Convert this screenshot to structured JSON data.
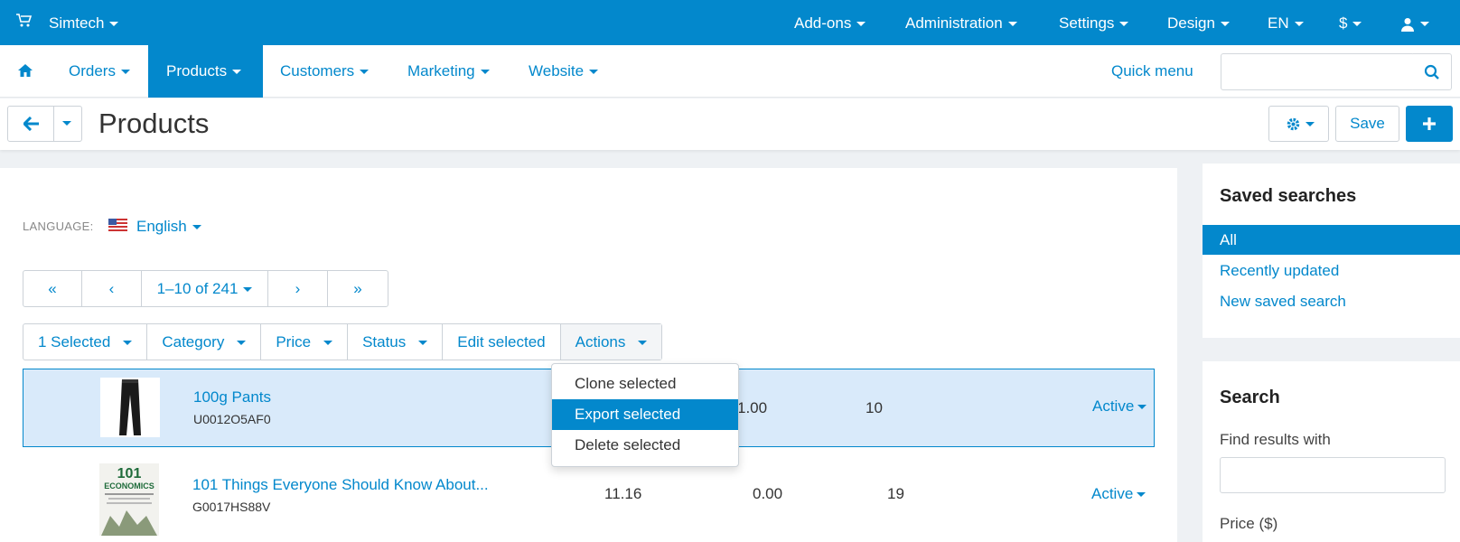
{
  "topbar": {
    "store": "Simtech",
    "menu": [
      "Add-ons",
      "Administration",
      "Settings",
      "Design",
      "EN",
      "$"
    ]
  },
  "nav": {
    "items": [
      "Orders",
      "Products",
      "Customers",
      "Marketing",
      "Website"
    ],
    "active": "Products",
    "quick_menu": "Quick menu",
    "search_placeholder": ""
  },
  "titlebar": {
    "title": "Products",
    "save": "Save"
  },
  "language": {
    "label": "LANGUAGE:",
    "value": "English"
  },
  "pager": {
    "first": "«",
    "prev": "‹",
    "range": "1–10 of 241",
    "next": "›",
    "last": "»"
  },
  "toolbar": {
    "selected": "1 Selected",
    "category": "Category",
    "price": "Price",
    "status": "Status",
    "edit_selected": "Edit selected",
    "actions": "Actions"
  },
  "actions_menu": [
    "Clone selected",
    "Export selected",
    "Delete selected"
  ],
  "products": [
    {
      "name": "100g Pants",
      "code": "U0012O5AF0",
      "price": "",
      "list_price": "1.00",
      "quantity": "10",
      "status": "Active",
      "selected": true
    },
    {
      "name": "101 Things Everyone Should Know About...",
      "code": "G0017HS88V",
      "price": "11.16",
      "list_price": "0.00",
      "quantity": "19",
      "status": "Active",
      "selected": false
    }
  ],
  "saved_searches": {
    "title": "Saved searches",
    "items": [
      "All",
      "Recently updated",
      "New saved search"
    ]
  },
  "search_panel": {
    "title": "Search",
    "find_label": "Find results with",
    "price_label": "Price ($)"
  },
  "colors": {
    "primary": "#0388cc",
    "selected_row": "#d9eafa"
  }
}
